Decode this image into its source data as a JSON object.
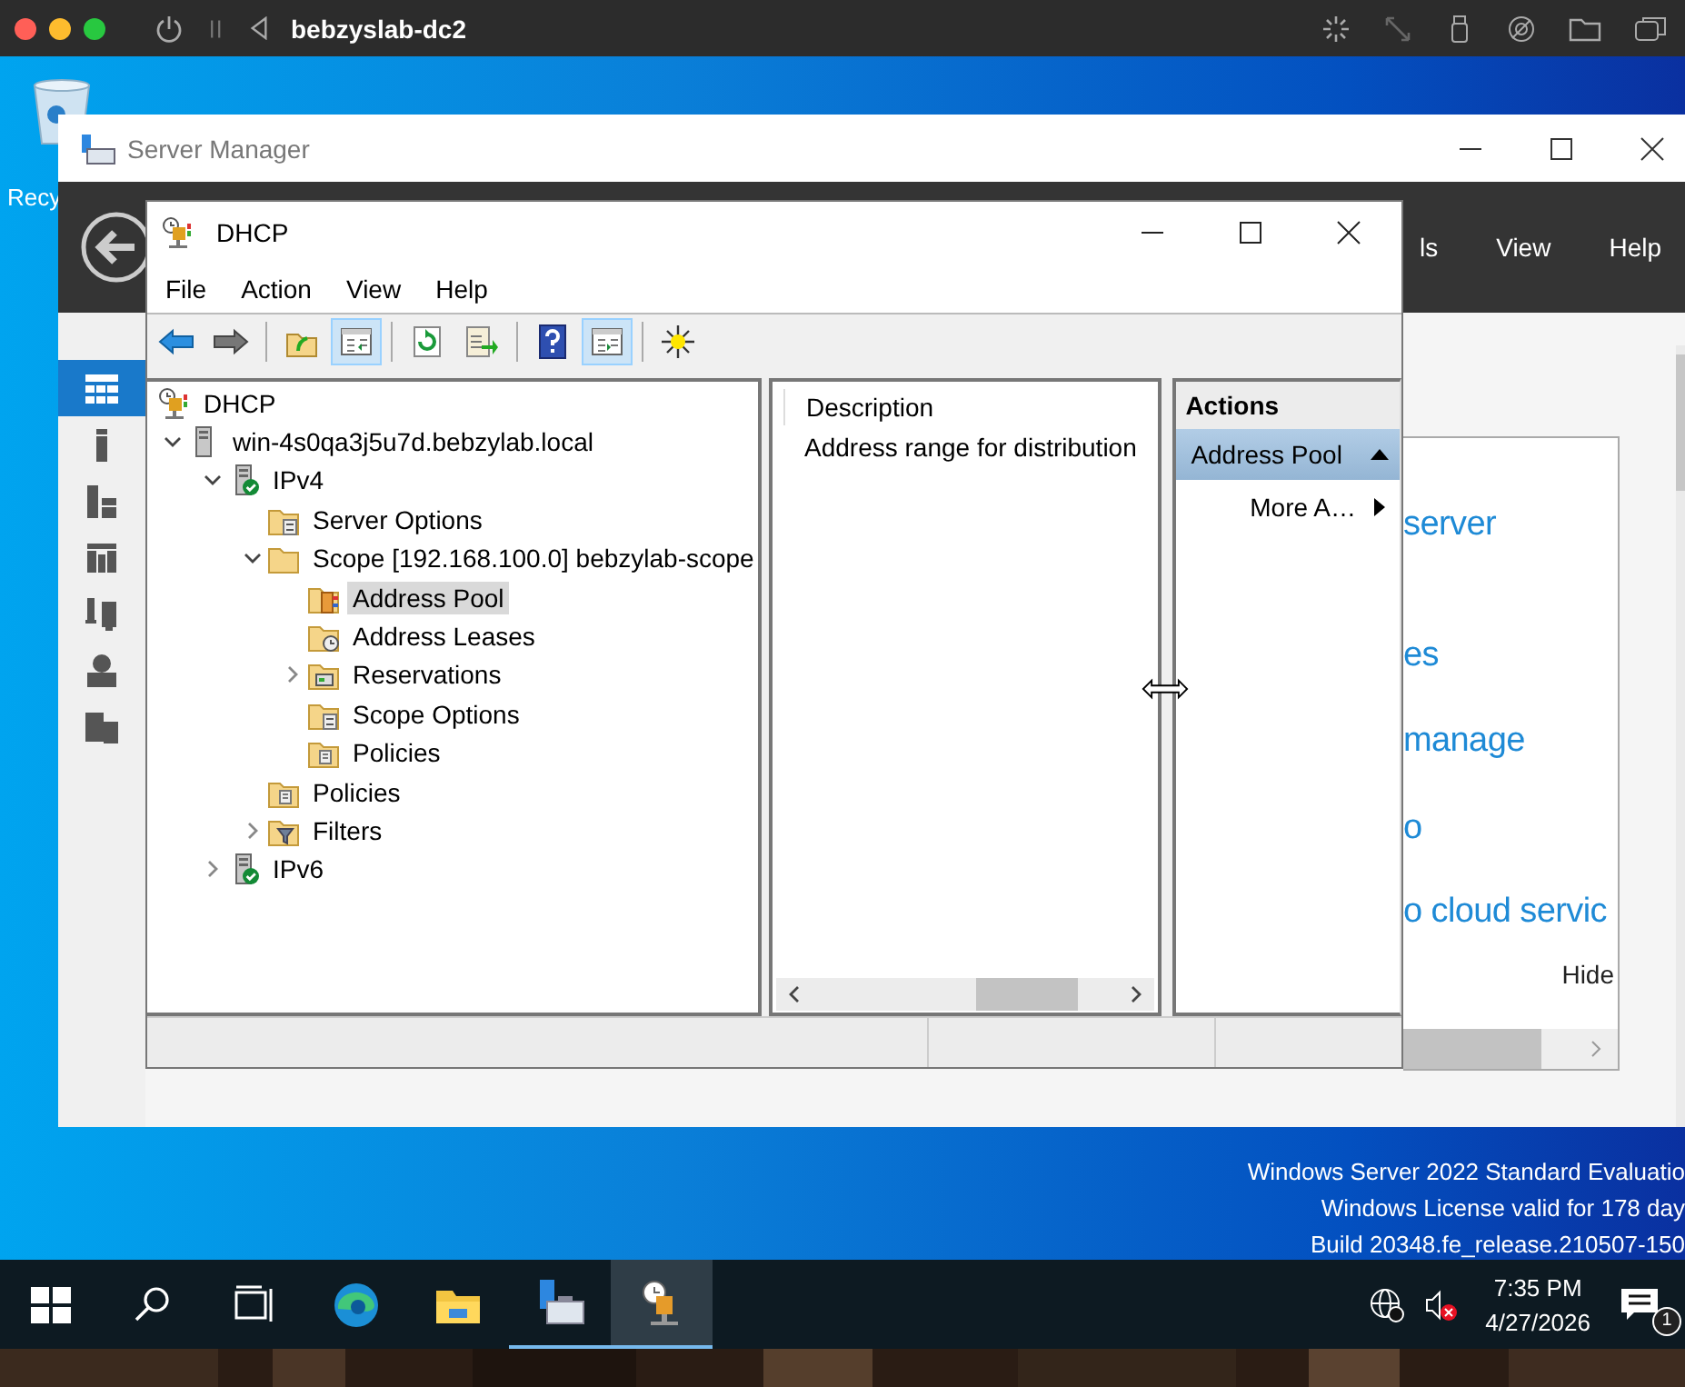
{
  "host_bar": {
    "title": "bebzyslab-dc2"
  },
  "desktop": {
    "icon_label": "Recy",
    "notice_lines": [
      "Windows Server 2022 Standard Evaluatio",
      "Windows License valid for 178 day",
      "Build 20348.fe_release.210507-150"
    ]
  },
  "server_manager": {
    "title": "Server Manager",
    "menu": [
      "ls",
      "View",
      "Help"
    ],
    "nav": [
      {
        "kind": "dashboard",
        "selected": true
      },
      {
        "kind": "local-server",
        "selected": false
      },
      {
        "kind": "all-servers",
        "selected": false
      },
      {
        "kind": "ad",
        "selected": false
      },
      {
        "kind": "dhcp",
        "selected": false
      },
      {
        "kind": "dns",
        "selected": false
      },
      {
        "kind": "files",
        "selected": false
      }
    ],
    "content_lines": [
      "server",
      "es",
      "manage",
      "o",
      "o cloud servic"
    ],
    "hide_link": "Hide"
  },
  "dhcp": {
    "title": "DHCP",
    "menu": [
      "File",
      "Action",
      "View",
      "Help"
    ],
    "toolbar": [
      [
        {
          "kind": "back",
          "pressed": false
        },
        {
          "kind": "forward",
          "pressed": false
        }
      ],
      [
        {
          "kind": "up",
          "pressed": false
        },
        {
          "kind": "tree",
          "pressed": true
        }
      ],
      [
        {
          "kind": "refresh",
          "pressed": false
        },
        {
          "kind": "export",
          "pressed": false
        }
      ],
      [
        {
          "kind": "help",
          "pressed": false
        },
        {
          "kind": "action-pane",
          "pressed": true
        }
      ],
      [
        {
          "kind": "star",
          "pressed": false
        }
      ]
    ],
    "tree": [
      {
        "label": "DHCP",
        "kind": "dhcp",
        "selected": false,
        "children": [
          {
            "label": "win-4s0qa3j5u7d.bebzylab.local",
            "kind": "server",
            "expanded": true,
            "selected": false,
            "children": [
              {
                "label": "IPv4",
                "kind": "server-ok",
                "expanded": true,
                "selected": false,
                "children": [
                  {
                    "label": "Server Options",
                    "kind": "folder-options",
                    "selected": false
                  },
                  {
                    "label": "Scope [192.168.100.0] bebzylab-scope",
                    "kind": "folder",
                    "expanded": true,
                    "selected": false,
                    "children": [
                      {
                        "label": "Address Pool",
                        "kind": "folder-pool",
                        "selected": true
                      },
                      {
                        "label": "Address Leases",
                        "kind": "folder-leases",
                        "selected": false
                      },
                      {
                        "label": "Reservations",
                        "kind": "folder-reservations",
                        "expanded": false,
                        "selected": false
                      },
                      {
                        "label": "Scope Options",
                        "kind": "folder-options",
                        "selected": false
                      },
                      {
                        "label": "Policies",
                        "kind": "folder-policies",
                        "selected": false
                      }
                    ]
                  },
                  {
                    "label": "Policies",
                    "kind": "folder-policies",
                    "selected": false
                  },
                  {
                    "label": "Filters",
                    "kind": "folder-filter",
                    "expanded": false,
                    "selected": false
                  }
                ]
              },
              {
                "label": "IPv6",
                "kind": "server-ok",
                "expanded": false,
                "selected": false
              }
            ]
          }
        ]
      }
    ],
    "details": {
      "column": "Description",
      "rows": [
        "Address range for distribution"
      ]
    },
    "actions": {
      "title": "Actions",
      "section": "Address Pool",
      "expanded": true,
      "items": [
        "More A…"
      ]
    }
  },
  "taskbar": {
    "apps": [
      {
        "kind": "start",
        "running": false,
        "selected": false
      },
      {
        "kind": "search",
        "running": false,
        "selected": false
      },
      {
        "kind": "task-view",
        "running": false,
        "selected": false
      },
      {
        "kind": "edge",
        "running": false,
        "selected": false
      },
      {
        "kind": "explorer",
        "running": false,
        "selected": false
      },
      {
        "kind": "server-manager",
        "running": true,
        "selected": false
      },
      {
        "kind": "dhcp",
        "running": true,
        "selected": true
      }
    ],
    "time": "7:35 PM",
    "date": "4/27/2026",
    "notifications": "1"
  }
}
